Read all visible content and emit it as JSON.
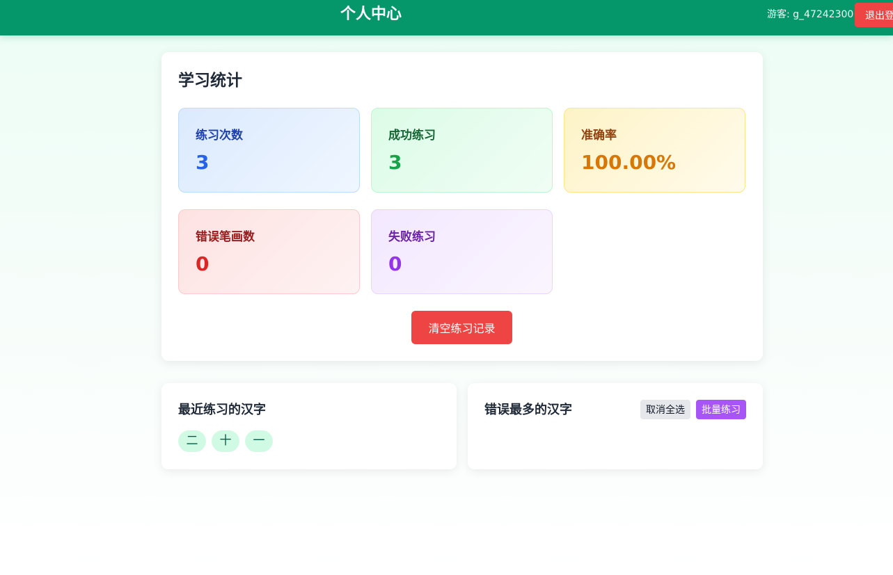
{
  "header": {
    "title": "个人中心",
    "user": "游客: g_47242300",
    "logout_label": "退出登"
  },
  "stats": {
    "title": "学习统计",
    "items": [
      {
        "label": "练习次数",
        "value": "3"
      },
      {
        "label": "成功练习",
        "value": "3"
      },
      {
        "label": "准确率",
        "value": "100.00%"
      },
      {
        "label": "错误笔画数",
        "value": "0"
      },
      {
        "label": "失败练习",
        "value": "0"
      }
    ],
    "clear_label": "清空练习记录"
  },
  "recent": {
    "title": "最近练习的汉字",
    "chars": [
      "二",
      "十",
      "一"
    ]
  },
  "mistakes": {
    "title": "错误最多的汉字",
    "deselect_label": "取消全选",
    "batch_label": "批量练习"
  },
  "colors": {
    "header": "#059669",
    "danger": "#ef4444",
    "batch": "#a855f7",
    "chip": "#d1fae5"
  }
}
